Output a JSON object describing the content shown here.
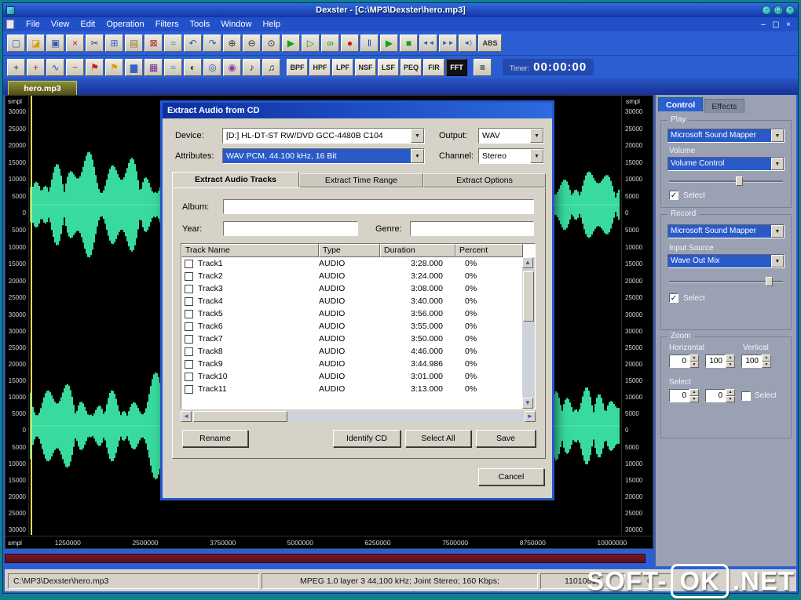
{
  "glyphs": {
    "dropdown": "▼",
    "check": "✓",
    "spin_up": "▲",
    "spin_down": "▼",
    "scroll_up": "▲",
    "scroll_down": "▼",
    "scroll_left": "◄",
    "scroll_right": "►",
    "minimize": "–",
    "maximize": "▢",
    "close": "×"
  },
  "colors": {
    "wave_green": "#3be6a6",
    "selection_blue": "#2a5ac8",
    "frame_blue": "#2458cc",
    "panel_gray": "#99a1b3",
    "maroon": "#6b1420",
    "teal": "#0d828c"
  },
  "titlebar": {
    "title": "Dexster - [C:\\MP3\\Dexster\\hero.mp3]"
  },
  "menubar": {
    "items": [
      "File",
      "View",
      "Edit",
      "Operation",
      "Filters",
      "Tools",
      "Window",
      "Help"
    ]
  },
  "toolbar1": {
    "abs_label": "ABS",
    "icons": [
      {
        "name": "new-file-icon",
        "glyph": "▢",
        "color": "#3b63c4"
      },
      {
        "name": "open-folder-icon",
        "glyph": "◪",
        "color": "#d89b12"
      },
      {
        "name": "save-file-icon",
        "glyph": "▣",
        "color": "#2f57b5"
      },
      {
        "name": "close-file-icon",
        "glyph": "×",
        "color": "#c81e1e"
      },
      {
        "name": "cut-icon",
        "glyph": "✂",
        "color": "#444444"
      },
      {
        "name": "copy-icon",
        "glyph": "⊞",
        "color": "#3b63c4"
      },
      {
        "name": "paste-icon",
        "glyph": "▤",
        "color": "#9a7a2a"
      },
      {
        "name": "delete-icon",
        "glyph": "⊠",
        "color": "#b02020"
      },
      {
        "name": "mix-icon",
        "glyph": "≈",
        "color": "#2f9a8a"
      },
      {
        "name": "undo-icon",
        "glyph": "↶",
        "color": "#2f57b5"
      },
      {
        "name": "redo-icon",
        "glyph": "↷",
        "color": "#2f57b5"
      },
      {
        "name": "zoom-in-icon",
        "glyph": "⊕",
        "color": "#333333"
      },
      {
        "name": "zoom-out-icon",
        "glyph": "⊖",
        "color": "#333333"
      },
      {
        "name": "zoom-selection-icon",
        "glyph": "⊙",
        "color": "#333333"
      },
      {
        "name": "play-icon",
        "glyph": "▶",
        "color": "#13a113"
      },
      {
        "name": "play-all-icon",
        "glyph": "▷",
        "color": "#13a113"
      },
      {
        "name": "loop-icon",
        "glyph": "∞",
        "color": "#13a113"
      },
      {
        "name": "record-icon",
        "glyph": "●",
        "color": "#d41414"
      },
      {
        "name": "pause-icon",
        "glyph": "‖",
        "color": "#1848c0"
      },
      {
        "name": "play-selection-icon",
        "glyph": "▶",
        "color": "#13a113"
      },
      {
        "name": "stop-icon",
        "glyph": "■",
        "color": "#13a113"
      },
      {
        "name": "play-from-start-icon",
        "glyph": "◄◄",
        "color": "#2f57b5"
      },
      {
        "name": "play-to-end-icon",
        "glyph": "►►",
        "color": "#2f57b5"
      },
      {
        "name": "speaker-icon",
        "glyph": "◄)",
        "color": "#2f57b5"
      }
    ]
  },
  "toolbar2": {
    "filter_buttons": [
      "BPF",
      "HPF",
      "LPF",
      "NSF",
      "LSF",
      "PEQ",
      "FIR",
      "FFT"
    ],
    "mixer_icon": {
      "name": "mixer-icon",
      "glyph": "≡",
      "color": "#333333"
    },
    "timer_label": "Timer:",
    "timer_value": "00:00:00",
    "icons": [
      {
        "name": "pan-icon",
        "glyph": "+",
        "color": "#333333"
      },
      {
        "name": "add-marker-icon",
        "glyph": "+",
        "color": "#c02020"
      },
      {
        "name": "waveform-icon",
        "glyph": "∿",
        "color": "#2f57b5"
      },
      {
        "name": "remove-marker-icon",
        "glyph": "−",
        "color": "#c02020"
      },
      {
        "name": "red-flag-icon",
        "glyph": "⚑",
        "color": "#c02020"
      },
      {
        "name": "yellow-flag-icon",
        "glyph": "⚑",
        "color": "#d8a010"
      },
      {
        "name": "spectrum-icon",
        "glyph": "▆",
        "color": "#3b63c4"
      },
      {
        "name": "stats-icon",
        "glyph": "▦",
        "color": "#7a2a9a"
      },
      {
        "name": "cyan-wave-icon",
        "glyph": "≈",
        "color": "#18a0b8"
      },
      {
        "name": "invert-icon",
        "glyph": "◐",
        "color": "#333333"
      },
      {
        "name": "cycle-icon",
        "glyph": "◎",
        "color": "#2f57b5"
      },
      {
        "name": "phase-icon",
        "glyph": "◉",
        "color": "#8a3a9a"
      },
      {
        "name": "note-icon",
        "glyph": "♪",
        "color": "#222222"
      },
      {
        "name": "notes-icon",
        "glyph": "♫",
        "color": "#222222"
      }
    ]
  },
  "document_tab": {
    "label": "hero.mp3"
  },
  "waveform": {
    "unit_label": "smpl",
    "amplitude_ticks": [
      "30000",
      "25000",
      "20000",
      "15000",
      "10000",
      "5000",
      "0",
      "5000",
      "10000",
      "15000",
      "20000",
      "25000",
      "30000"
    ],
    "bottom_ticks": [
      "1250000",
      "2500000",
      "3750000",
      "5000000",
      "6250000",
      "7500000",
      "8750000",
      "10000000"
    ]
  },
  "dialog": {
    "title": "Extract Audio from CD",
    "device_label": "Device:",
    "device_value": "[D:] HL-DT-ST  RW/DVD GCC-4480B  C104",
    "output_label": "Output:",
    "output_value": "WAV",
    "attributes_label": "Attributes:",
    "attributes_value": "WAV PCM, 44.100 kHz, 16 Bit",
    "channel_label": "Channel:",
    "channel_value": "Stereo",
    "tabs": [
      "Extract Audio Tracks",
      "Extract Time Range",
      "Extract Options"
    ],
    "active_tab": "Extract Audio Tracks",
    "album_label": "Album:",
    "year_label": "Year:",
    "genre_label": "Genre:",
    "table": {
      "headers": [
        "Track Name",
        "Type",
        "Duration",
        "Percent"
      ],
      "rows": [
        {
          "name": "Track1",
          "type": "AUDIO",
          "duration": "3:28.000",
          "percent": "0%"
        },
        {
          "name": "Track2",
          "type": "AUDIO",
          "duration": "3:24.000",
          "percent": "0%"
        },
        {
          "name": "Track3",
          "type": "AUDIO",
          "duration": "3:08.000",
          "percent": "0%"
        },
        {
          "name": "Track4",
          "type": "AUDIO",
          "duration": "3:40.000",
          "percent": "0%"
        },
        {
          "name": "Track5",
          "type": "AUDIO",
          "duration": "3:56.000",
          "percent": "0%"
        },
        {
          "name": "Track6",
          "type": "AUDIO",
          "duration": "3:55.000",
          "percent": "0%"
        },
        {
          "name": "Track7",
          "type": "AUDIO",
          "duration": "3:50.000",
          "percent": "0%"
        },
        {
          "name": "Track8",
          "type": "AUDIO",
          "duration": "4:46.000",
          "percent": "0%"
        },
        {
          "name": "Track9",
          "type": "AUDIO",
          "duration": "3:44.986",
          "percent": "0%"
        },
        {
          "name": "Track10",
          "type": "AUDIO",
          "duration": "3:01.000",
          "percent": "0%"
        },
        {
          "name": "Track11",
          "type": "AUDIO",
          "duration": "3:13.000",
          "percent": "0%"
        }
      ]
    },
    "buttons": {
      "rename": "Rename",
      "identify": "Identify CD",
      "select_all": "Select All",
      "save": "Save",
      "cancel": "Cancel"
    }
  },
  "side_panel": {
    "tabs": [
      "Control",
      "Effects"
    ],
    "active_tab": "Control",
    "play_group": {
      "label": "Play",
      "device": "Microsoft Sound Mapper",
      "volume_label": "Volume",
      "volume_device": "Volume Control",
      "volume_percent": 62,
      "select_label": "Select",
      "select_checked": true
    },
    "record_group": {
      "label": "Record",
      "device": "Microsoft Sound Mapper",
      "input_source_label": "Input Source",
      "input_source_value": "Wave Out Mix",
      "level_percent": 88,
      "select_label": "Select",
      "select_checked": true
    },
    "zoom_group": {
      "label": "Zoom",
      "horizontal_label": "Horizontal",
      "vertical_label": "Vertical",
      "h_position": "0",
      "h_zoom": "100",
      "v_zoom": "100",
      "select_label": "Select",
      "select_h": "0",
      "select_v": "0",
      "select_checkbox_label": "Select",
      "select_checked": false
    }
  },
  "statusbar": {
    "file_path": "C:\\MP3\\Dexster\\hero.mp3",
    "format_info": "MPEG 1.0 layer 3  44,100 kHz; Joint Stereo; 160 Kbps;",
    "sample_count": "11010816",
    "position": "0"
  },
  "watermark": {
    "part1": "SOFT-",
    "boxed": "OK",
    "part2": ".NET"
  }
}
